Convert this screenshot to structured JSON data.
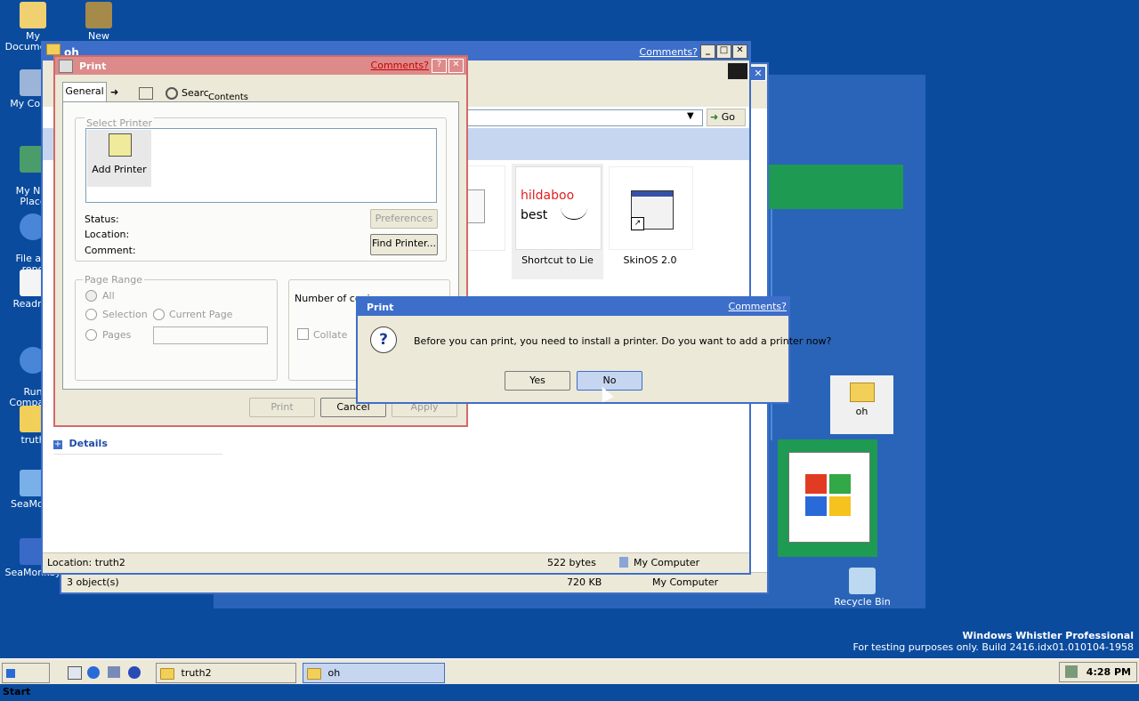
{
  "desktop": {
    "icons": [
      {
        "label": "My Documents"
      },
      {
        "label": "New Briefcase"
      },
      {
        "label": "My Comp"
      },
      {
        "label": "My Net\nPlace"
      },
      {
        "label": "File a b\nrepo"
      },
      {
        "label": "Readme"
      },
      {
        "label": "Run\nCompatib"
      },
      {
        "label": "truth"
      },
      {
        "label": "SeaMonk"
      },
      {
        "label": "SeaMonkey"
      }
    ],
    "oh_icon_label": "oh",
    "recycle_bin_label": "Recycle Bin",
    "watermark_line1": "Windows Whistler Professional",
    "watermark_line2": "For testing purposes only. Build 2416.idx01.010104-1958"
  },
  "explorer_oh": {
    "title": "oh",
    "comments": "Comments?",
    "go_label": "Go",
    "details_label": "Details",
    "items": [
      {
        "label": "Shortcut to Lie",
        "thumb_line1": "hildaboo",
        "thumb_line2": "best"
      },
      {
        "label": "SkinOS 2.0"
      }
    ],
    "status_location": "Location: truth2",
    "status_size": "522 bytes",
    "status_zone": "My Computer"
  },
  "explorer_back": {
    "status_objects": "3 object(s)",
    "status_size": "720 KB",
    "status_zone": "My Computer"
  },
  "print_dialog": {
    "title": "Print",
    "comments": "Comments?",
    "tabs": [
      "General",
      "Contents"
    ],
    "toolbar_search": "Searc",
    "select_printer_label": "Select Printer",
    "add_printer_label": "Add Printer",
    "status_label": "Status:",
    "location_label": "Location:",
    "comment_label": "Comment:",
    "preferences_btn": "Preferences",
    "find_printer_btn": "Find Printer...",
    "page_range_label": "Page Range",
    "all_label": "All",
    "selection_label": "Selection",
    "current_page_label": "Current Page",
    "pages_label": "Pages",
    "copies_label": "Number of copi",
    "collate_label": "Collate",
    "print_btn": "Print",
    "cancel_btn": "Cancel",
    "apply_btn": "Apply"
  },
  "message_box": {
    "title": "Print",
    "comments": "Comments?",
    "message": "Before you can print, you need to install a printer. Do you want to add a printer now?",
    "yes_label": "Yes",
    "no_label": "No"
  },
  "taskbar": {
    "start_label": "Start",
    "tasks": [
      {
        "label": "truth2"
      },
      {
        "label": "oh"
      }
    ],
    "clock": "4:28 PM"
  },
  "colors": {
    "desktop": "#0a4b9e",
    "titlebar": "#3d6ec9",
    "dialog_frame": "#d06a6a",
    "accent_green": "#1f9a53"
  }
}
